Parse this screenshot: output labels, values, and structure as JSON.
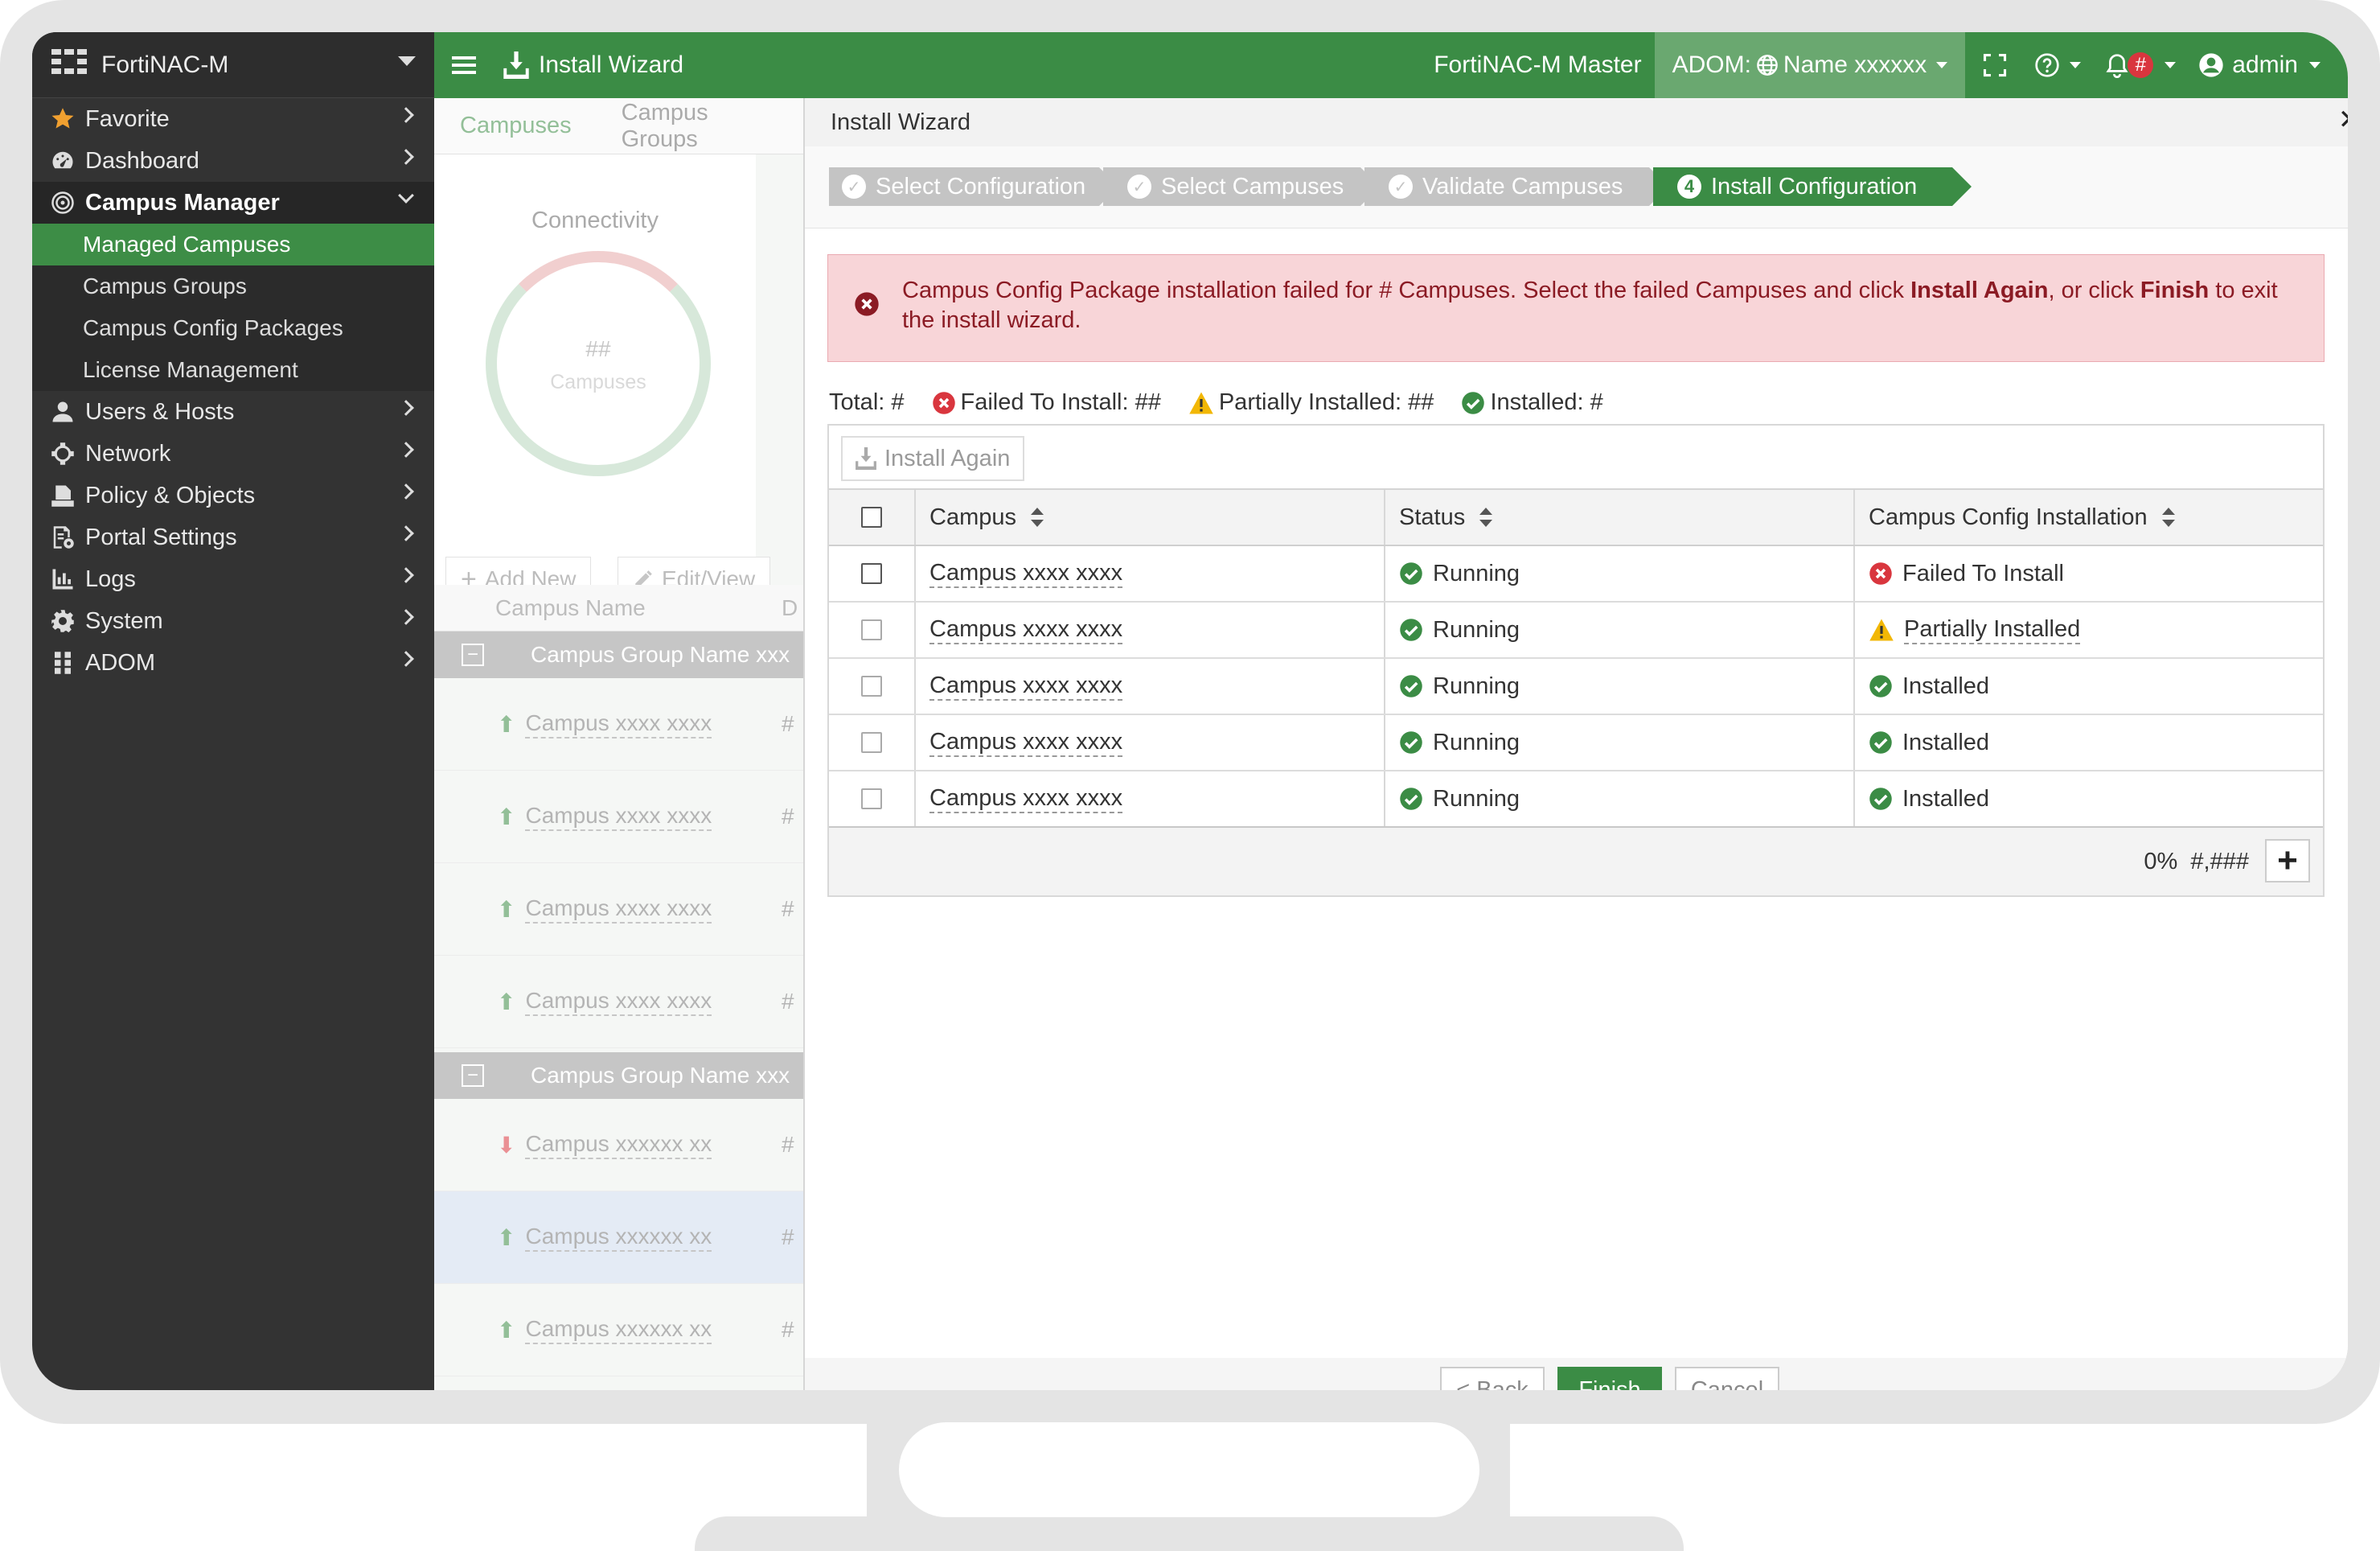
{
  "app": {
    "name": "FortiNAC-M"
  },
  "sidebar": {
    "items": [
      {
        "label": "Favorite",
        "icon": "star-icon"
      },
      {
        "label": "Dashboard",
        "icon": "dashboard-icon"
      },
      {
        "label": "Campus Manager",
        "icon": "campus-manager-icon"
      },
      {
        "label": "Users & Hosts",
        "icon": "user-icon"
      },
      {
        "label": "Network",
        "icon": "network-icon"
      },
      {
        "label": "Policy & Objects",
        "icon": "policy-icon"
      },
      {
        "label": "Portal Settings",
        "icon": "portal-settings-icon"
      },
      {
        "label": "Logs",
        "icon": "logs-icon"
      },
      {
        "label": "System",
        "icon": "gear-icon"
      },
      {
        "label": "ADOM",
        "icon": "adom-icon"
      }
    ],
    "campus_manager_sub": [
      "Managed Campuses",
      "Campus Groups",
      "Campus Config Packages",
      "License Management"
    ]
  },
  "topbar": {
    "page_title": "Install Wizard",
    "instance": "FortiNAC-M Master",
    "adom_label": "ADOM:",
    "adom_name": "Name xxxxxx",
    "notification_count": "#",
    "user": "admin"
  },
  "background": {
    "tabs": [
      "Campuses",
      "Campus Groups"
    ],
    "widget_title": "Connectivity",
    "donut_value": "##",
    "donut_label": "Campuses",
    "add_new": "Add New",
    "edit_view": "Edit/View",
    "col_name": "Campus Name",
    "col_d": "D",
    "group1": "Campus Group Name xxx",
    "group2": "Campus Group Name xxx",
    "rows1": [
      "Campus xxxx xxxx",
      "Campus xxxx xxxx",
      "Campus xxxx xxxx",
      "Campus xxxx xxxx"
    ],
    "rows2": [
      "Campus xxxxxx xx",
      "Campus xxxxxx xx",
      "Campus xxxxxx xx"
    ],
    "row_hash": "#"
  },
  "wizard": {
    "title": "Install Wizard",
    "steps": [
      {
        "label": "Select Configuration",
        "marker": "✓"
      },
      {
        "label": "Select Campuses",
        "marker": "✓"
      },
      {
        "label": "Validate Campuses",
        "marker": "✓"
      },
      {
        "label": "Install Configuration",
        "marker": "4"
      }
    ],
    "alert": {
      "part1": "Campus Config Package installation failed for # Campuses. Select the failed Campuses and click ",
      "install_again": "Install Again",
      "part2": ", or click ",
      "finish": "Finish",
      "part3": " to exit the install wizard."
    },
    "summary": {
      "total": "Total: #",
      "failed": "Failed To Install: ##",
      "partial": "Partially Installed: ##",
      "installed": "Installed: #"
    },
    "install_again_button": "Install Again",
    "columns": [
      "Campus",
      "Status",
      "Campus Config Installation"
    ],
    "rows": [
      {
        "campus": "Campus xxxx xxxx",
        "status": "Running",
        "install": "Failed To Install",
        "install_state": "failed"
      },
      {
        "campus": "Campus xxxx xxxx",
        "status": "Running",
        "install": "Partially Installed",
        "install_state": "partial"
      },
      {
        "campus": "Campus xxxx xxxx",
        "status": "Running",
        "install": "Installed",
        "install_state": "ok"
      },
      {
        "campus": "Campus xxxx xxxx",
        "status": "Running",
        "install": "Installed",
        "install_state": "ok"
      },
      {
        "campus": "Campus xxxx xxxx",
        "status": "Running",
        "install": "Installed",
        "install_state": "ok"
      }
    ],
    "footer_progress": "0%",
    "footer_count": "#,###",
    "buttons": {
      "back": "< Back",
      "finish": "Finish",
      "cancel": "Cancel"
    }
  },
  "colors": {
    "brand_green": "#3b8c45",
    "error_red": "#d9363e",
    "warning_yellow": "#f2b705",
    "success_green": "#3b8c45"
  }
}
